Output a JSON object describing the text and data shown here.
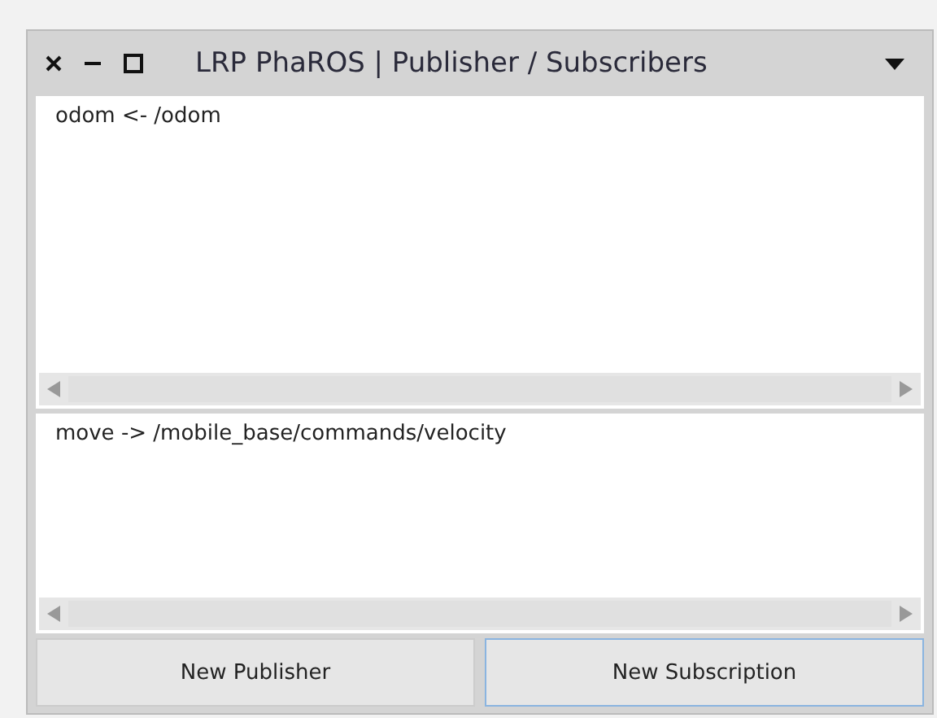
{
  "window": {
    "title": "LRP PhaROS | Publisher / Subscribers"
  },
  "panes": [
    {
      "lines": [
        "odom <- /odom"
      ]
    },
    {
      "lines": [
        "move -> /mobile_base/commands/velocity"
      ]
    }
  ],
  "buttons": [
    {
      "label": "New Publisher",
      "focused": false
    },
    {
      "label": "New Subscription",
      "focused": true
    }
  ]
}
